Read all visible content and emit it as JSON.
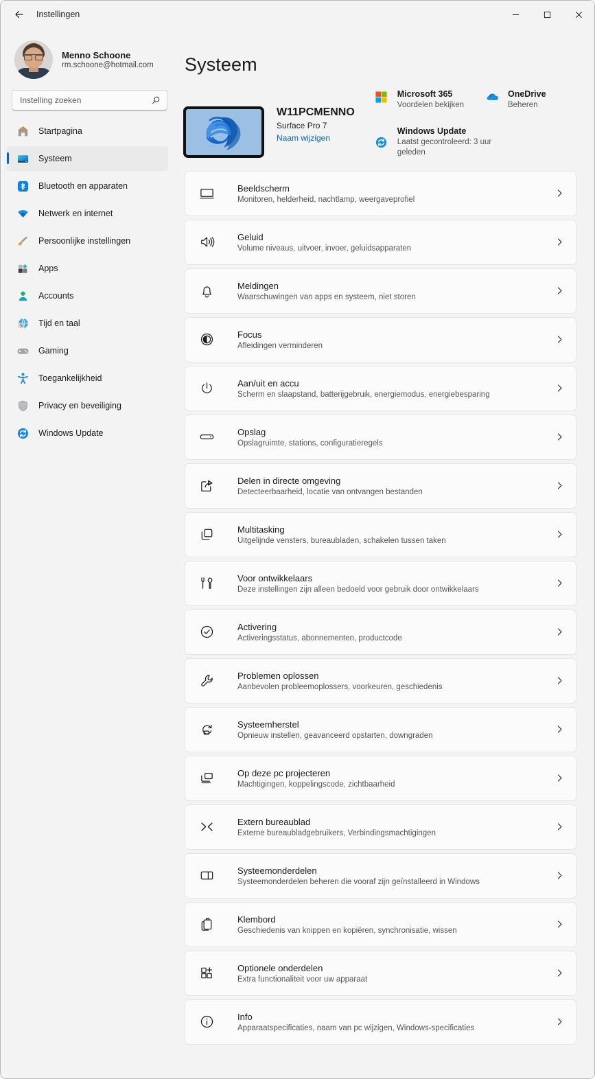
{
  "titlebar": {
    "back_label": "back-arrow",
    "app_title": "Instellingen",
    "minimize": "minimize-icon",
    "maximize": "maximize-icon",
    "close": "close-icon"
  },
  "sidebar": {
    "profile": {
      "name": "Menno Schoone",
      "email": "rm.schoone@hotmail.com"
    },
    "search": {
      "placeholder": "Instelling zoeken",
      "value": ""
    },
    "items": [
      {
        "label": "Startpagina",
        "icon": "home-icon",
        "selected": false
      },
      {
        "label": "Systeem",
        "icon": "system-icon",
        "selected": true
      },
      {
        "label": "Bluetooth en apparaten",
        "icon": "bluetooth-icon",
        "selected": false
      },
      {
        "label": "Netwerk en internet",
        "icon": "network-icon",
        "selected": false
      },
      {
        "label": "Persoonlijke instellingen",
        "icon": "brush-icon",
        "selected": false
      },
      {
        "label": "Apps",
        "icon": "apps-icon",
        "selected": false
      },
      {
        "label": "Accounts",
        "icon": "account-icon",
        "selected": false
      },
      {
        "label": "Tijd en taal",
        "icon": "clock-globe-icon",
        "selected": false
      },
      {
        "label": "Gaming",
        "icon": "gamepad-icon",
        "selected": false
      },
      {
        "label": "Toegankelijkheid",
        "icon": "accessibility-icon",
        "selected": false
      },
      {
        "label": "Privacy en beveiliging",
        "icon": "shield-icon",
        "selected": false
      },
      {
        "label": "Windows Update",
        "icon": "update-icon",
        "selected": false
      }
    ]
  },
  "main": {
    "page_title": "Systeem",
    "device": {
      "name": "W11PCMENNO",
      "model": "Surface Pro 7",
      "rename_link": "Naam wijzigen"
    },
    "services": [
      {
        "title": "Microsoft 365",
        "subtitle": "Voordelen bekijken",
        "icon": "microsoft-logo-icon"
      },
      {
        "title": "OneDrive",
        "subtitle": "Beheren",
        "icon": "onedrive-icon"
      },
      {
        "title": "Windows Update",
        "subtitle": "Laatst gecontroleerd: 3 uur geleden",
        "icon": "windows-update-icon"
      }
    ],
    "settings_rows": [
      {
        "title": "Beeldscherm",
        "subtitle": "Monitoren, helderheid, nachtlamp, weergaveprofiel",
        "icon": "display-icon"
      },
      {
        "title": "Geluid",
        "subtitle": "Volume niveaus, uitvoer, invoer, geluidsapparaten",
        "icon": "sound-icon"
      },
      {
        "title": "Meldingen",
        "subtitle": "Waarschuwingen van apps en systeem, niet storen",
        "icon": "bell-icon"
      },
      {
        "title": "Focus",
        "subtitle": "Afleidingen verminderen",
        "icon": "focus-icon"
      },
      {
        "title": "Aan/uit en accu",
        "subtitle": "Scherm en slaapstand, batterijgebruik, energiemodus, energiebesparing",
        "icon": "power-icon"
      },
      {
        "title": "Opslag",
        "subtitle": "Opslagruimte, stations, configuratieregels",
        "icon": "storage-icon"
      },
      {
        "title": "Delen in directe omgeving",
        "subtitle": "Detecteerbaarheid, locatie van ontvangen bestanden",
        "icon": "nearby-share-icon"
      },
      {
        "title": "Multitasking",
        "subtitle": "Uitgelijnde vensters, bureaubladen, schakelen tussen taken",
        "icon": "multitasking-icon"
      },
      {
        "title": "Voor ontwikkelaars",
        "subtitle": "Deze instellingen zijn alleen bedoeld voor gebruik door ontwikkelaars",
        "icon": "developer-icon"
      },
      {
        "title": "Activering",
        "subtitle": "Activeringsstatus, abonnementen, productcode",
        "icon": "activation-icon"
      },
      {
        "title": "Problemen oplossen",
        "subtitle": "Aanbevolen probleemoplossers, voorkeuren, geschiedenis",
        "icon": "wrench-icon"
      },
      {
        "title": "Systeemherstel",
        "subtitle": "Opnieuw instellen, geavanceerd opstarten, downgraden",
        "icon": "recovery-icon"
      },
      {
        "title": "Op deze pc projecteren",
        "subtitle": "Machtigingen, koppelingscode, zichtbaarheid",
        "icon": "project-icon"
      },
      {
        "title": "Extern bureaublad",
        "subtitle": "Externe bureaubladgebruikers, Verbindingsmachtigingen",
        "icon": "remote-desktop-icon"
      },
      {
        "title": "Systeemonderdelen",
        "subtitle": "Systeemonderdelen beheren die vooraf zijn geïnstalleerd in Windows",
        "icon": "system-components-icon"
      },
      {
        "title": "Klembord",
        "subtitle": "Geschiedenis van knippen en kopiëren, synchronisatie, wissen",
        "icon": "clipboard-icon"
      },
      {
        "title": "Optionele onderdelen",
        "subtitle": "Extra functionaliteit voor uw apparaat",
        "icon": "optional-features-icon"
      },
      {
        "title": "Info",
        "subtitle": "Apparaatspecificaties, naam van pc wijzigen, Windows-specificaties",
        "icon": "info-icon"
      }
    ],
    "chevron": "chevron-right-icon"
  },
  "colors": {
    "accent": "#0067c0",
    "window_bg": "#f3f3f3",
    "card_bg": "#fbfbfb",
    "text": "#1b1b1b",
    "subtext": "#555555"
  }
}
